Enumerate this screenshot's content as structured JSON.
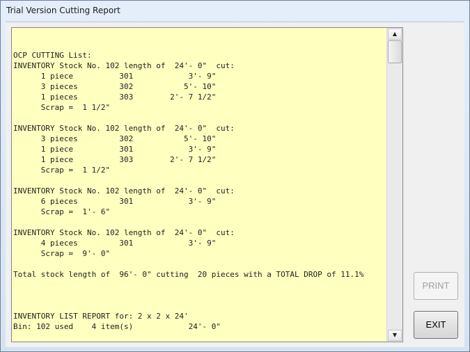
{
  "window": {
    "title": "Trial Version Cutting Report"
  },
  "report": {
    "lines": [
      "",
      "",
      "OCP CUTTING List:",
      "INVENTORY Stock No. 102 length of  24'- 0\"  cut:",
      "      1 piece          301            3'- 9\"",
      "      3 pieces         302           5'- 10\"",
      "      1 pieces         303        2'- 7 1/2\"",
      "      Scrap =  1 1/2\"",
      "",
      "INVENTORY Stock No. 102 length of  24'- 0\"  cut:",
      "      3 pieces         302           5'- 10\"",
      "      1 piece          301            3'- 9\"",
      "      1 piece          303        2'- 7 1/2\"",
      "      Scrap =  1 1/2\"",
      "",
      "INVENTORY Stock No. 102 length of  24'- 0\"  cut:",
      "      6 pieces         301            3'- 9\"",
      "      Scrap =  1'- 6\"",
      "",
      "INVENTORY Stock No. 102 length of  24'- 0\"  cut:",
      "      4 pieces         301            3'- 9\"",
      "      Scrap =  9'- 0\"",
      "",
      "Total stock length of  96'- 0\" cutting  20 pieces with a TOTAL DROP of 11.1%",
      "",
      "",
      "",
      "INVENTORY LIST REPORT for: 2 x 2 x 24'",
      "Bin: 102 used    4 item(s)            24'- 0\""
    ]
  },
  "scrollbar": {
    "up_glyph": "▲",
    "down_glyph": "▼"
  },
  "buttons": {
    "print_label": "PRINT",
    "exit_label": "EXIT"
  }
}
